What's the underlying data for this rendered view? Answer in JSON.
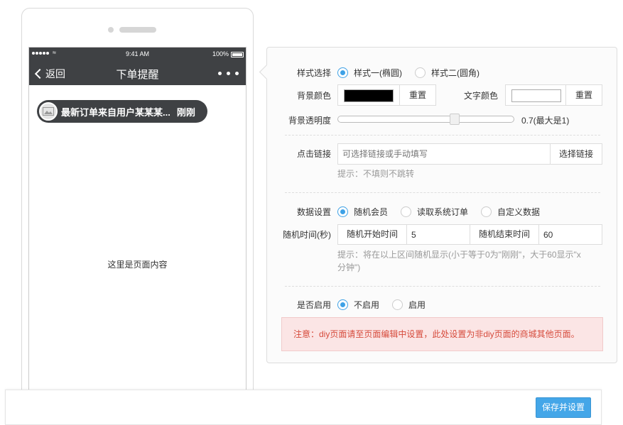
{
  "phone": {
    "status": {
      "time": "9:41 AM",
      "battery": "100%"
    },
    "nav": {
      "back_label": "返回",
      "title": "下单提醒"
    },
    "toast": {
      "message": "最新订单来自用户某某某...",
      "time": "刚刚"
    },
    "content_text": "这里是页面内容"
  },
  "settings": {
    "style": {
      "label": "样式选择",
      "options": [
        "样式一(椭圆)",
        "样式二(圆角)"
      ],
      "selected_index": 0
    },
    "bg_color": {
      "label": "背景颜色",
      "value": "#000000",
      "reset_label": "重置"
    },
    "text_color": {
      "label": "文字颜色",
      "value": "#ffffff",
      "reset_label": "重置"
    },
    "opacity": {
      "label": "背景透明度",
      "value": 0.7,
      "display": "0.7(最大是1)"
    },
    "link": {
      "label": "点击链接",
      "placeholder": "可选择链接或手动填写",
      "button_label": "选择链接",
      "hint": "提示：不填则不跳转"
    },
    "data": {
      "label": "数据设置",
      "options": [
        "随机会员",
        "读取系统订单",
        "自定义数据"
      ],
      "selected_index": 0
    },
    "random_time": {
      "label": "随机时间(秒)",
      "start_label": "随机开始时间",
      "start_value": "5",
      "end_label": "随机结束时间",
      "end_value": "60",
      "hint": "提示：将在以上区间随机显示(小于等于0为\"刚刚\"，大于60显示\"x分钟\")"
    },
    "enable": {
      "label": "是否启用",
      "options": [
        "不启用",
        "启用"
      ],
      "selected_index": 0
    },
    "notice": "注意：diy页面请至页面编辑中设置，此处设置为非diy页面的商城其他页面。"
  },
  "footer": {
    "save_label": "保存并设置"
  },
  "colors": {
    "accent": "#44a6e8",
    "nav_bg": "#3f4144",
    "notice_text": "#d64a3b",
    "notice_bg": "#fbe5e5"
  }
}
